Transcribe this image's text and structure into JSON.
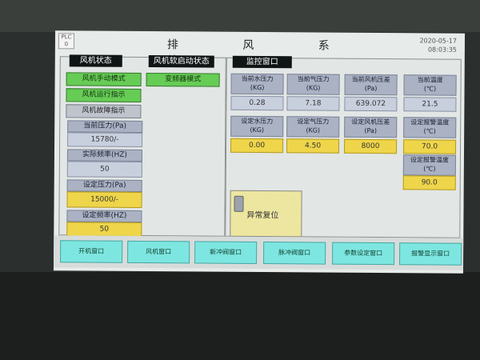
{
  "header": {
    "plc_label": "PLC",
    "plc_sub": "0",
    "title": "排 风 系 统",
    "date": "2020-05-17",
    "time": "08:03:35"
  },
  "left": {
    "status_header": "风机状态",
    "softstart_header": "风机软启动状态",
    "manual_mode": "风机手动模式",
    "run_indicator": "风机运行指示",
    "fault_indicator": "风机故障指示",
    "vfd_mode": "变频器模式",
    "current_pressure_label": "当前压力(Pa)",
    "current_pressure_value": "15780/-",
    "actual_freq_label": "实际频率(HZ)",
    "actual_freq_value": "50",
    "set_pressure_label": "设定压力(Pa)",
    "set_pressure_value": "15000/-",
    "set_freq_label": "设定频率(HZ)",
    "set_freq_value": "50"
  },
  "monitor": {
    "header": "监控窗口",
    "cells": [
      {
        "label": "当前水压力\n(KG)",
        "value": "0.28"
      },
      {
        "label": "当前气压力\n(KG)",
        "value": "7.18"
      },
      {
        "label": "当前风机压差\n(Pa)",
        "value": "639.072"
      },
      {
        "label": "当前温度\n(℃)",
        "value": "21.5"
      },
      {
        "label": "设定水压力\n(KG)",
        "value": "0.00"
      },
      {
        "label": "设定气压力\n(KG)",
        "value": "4.50"
      },
      {
        "label": "设定风机压差\n(Pa)",
        "value": "8000"
      },
      {
        "label": "设定报警温度\n(℃)",
        "value": "70.0"
      }
    ],
    "extra_label": "设定报警温度\n(℃)",
    "extra_value": "90.0",
    "reset_label": "异常复位"
  },
  "nav": [
    {
      "label": "开机窗口"
    },
    {
      "label": "风机窗口"
    },
    {
      "label": "新冲阀窗口"
    },
    {
      "label": "脉冲阀窗口"
    },
    {
      "label": "参数设定窗口"
    },
    {
      "label": "报警显示窗口"
    }
  ],
  "colors": {
    "green": "#66cc55",
    "yellow": "#efd54a",
    "label_blue": "#aab2c4",
    "nav_cyan": "#7ee6e0"
  }
}
